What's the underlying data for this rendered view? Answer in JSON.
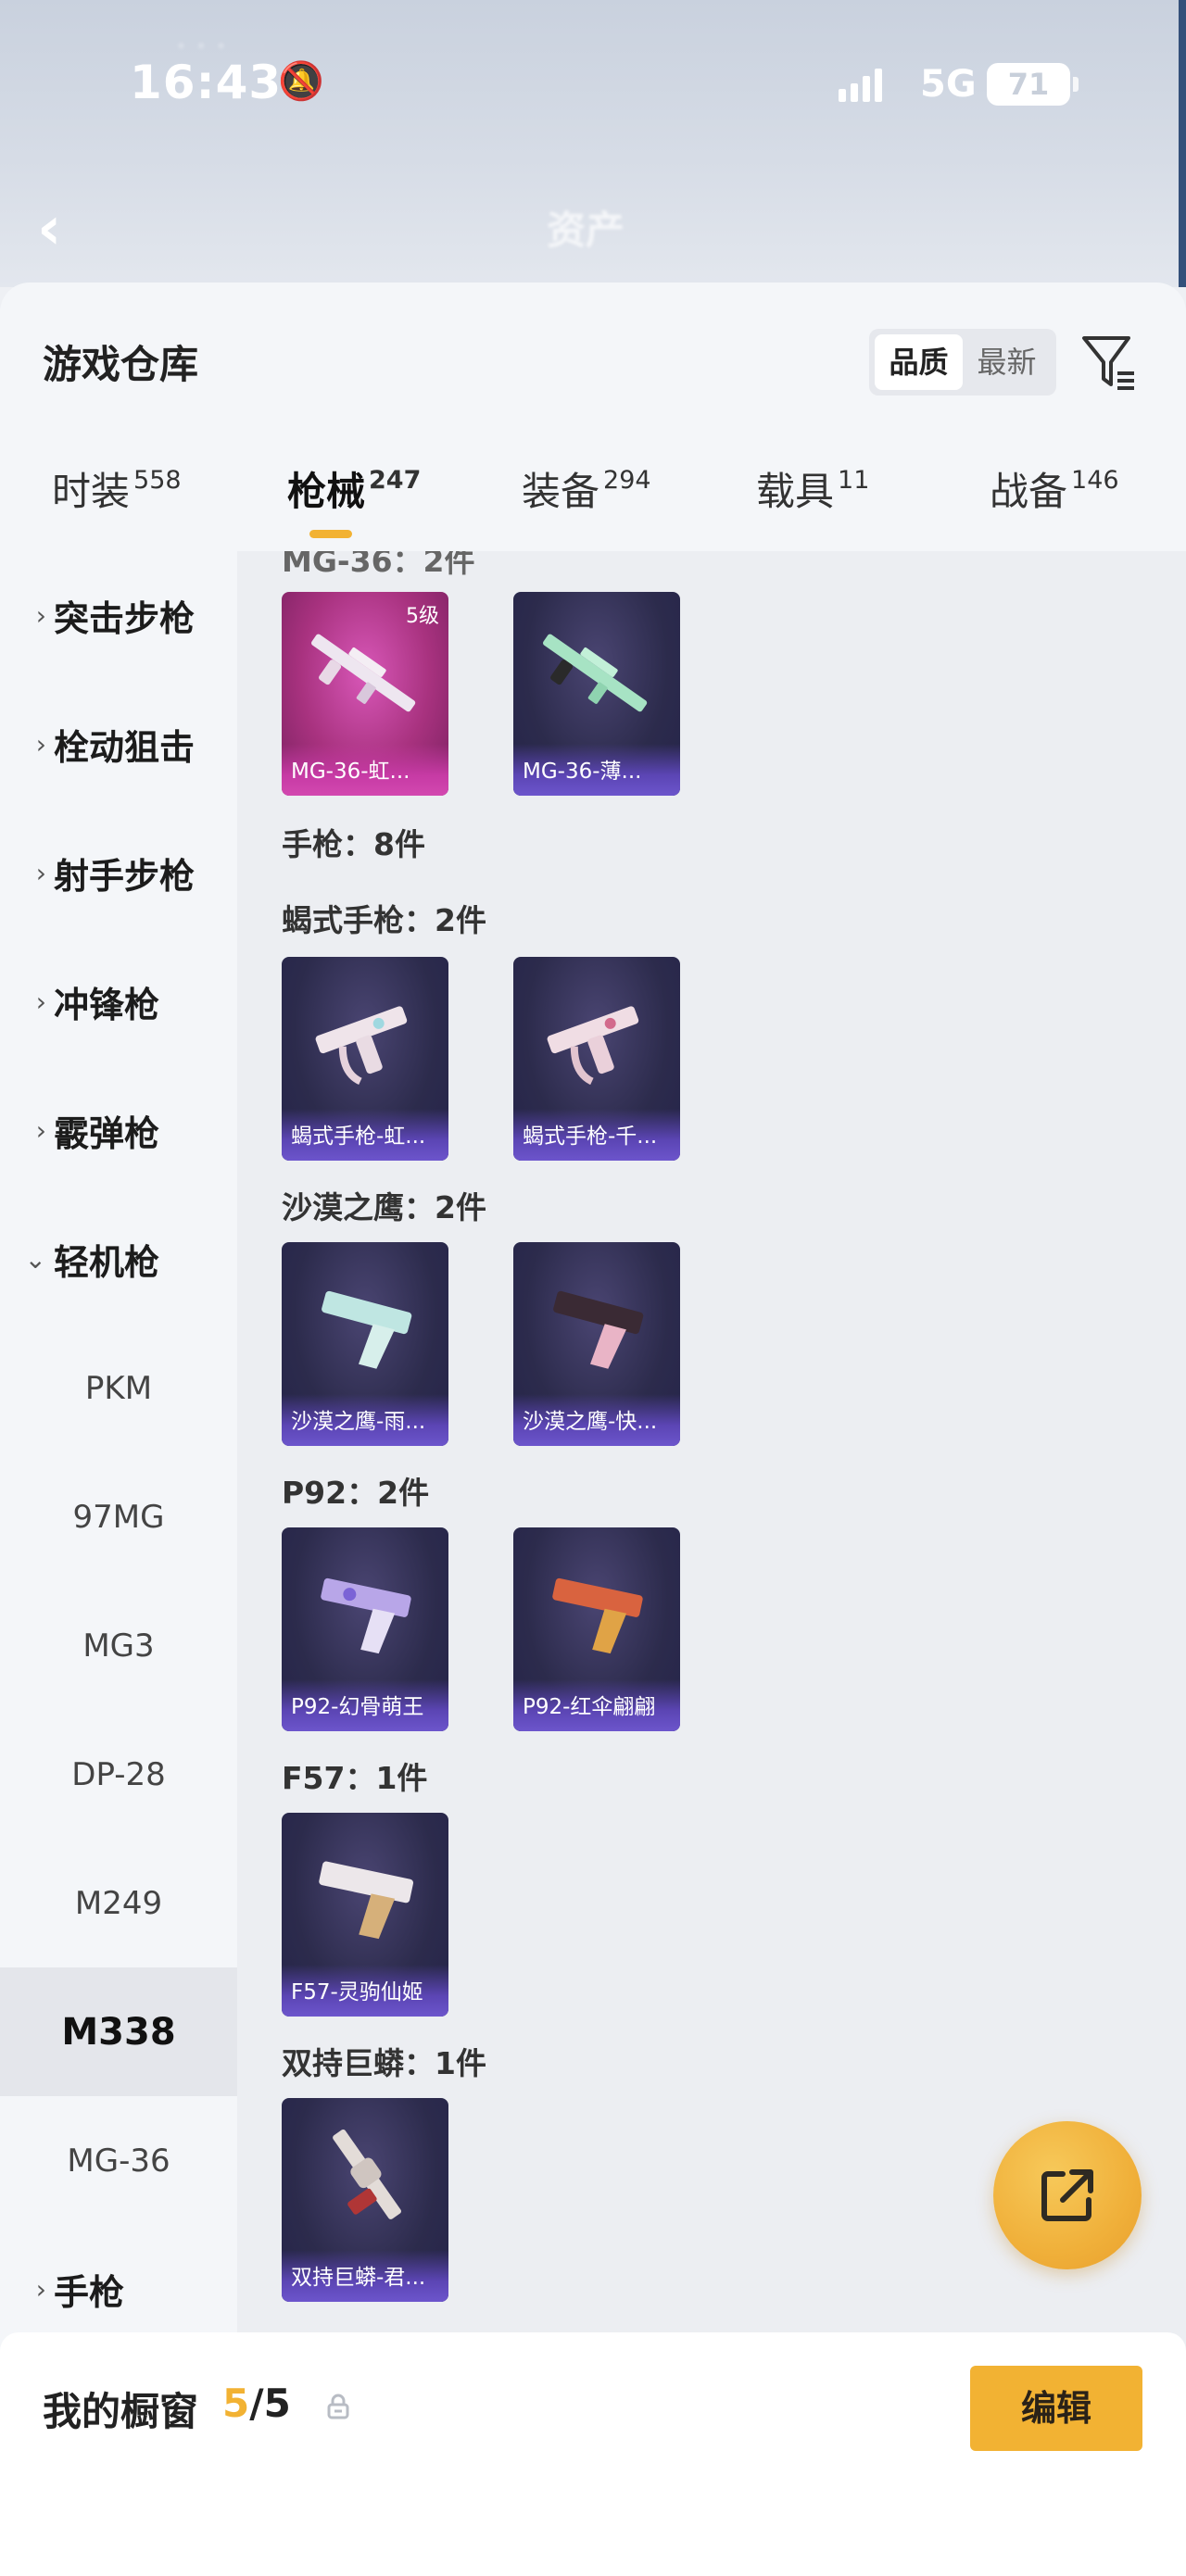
{
  "status_bar": {
    "time": "16:43",
    "network": "5G",
    "battery": "71"
  },
  "header": {
    "title": "资产",
    "back_icon": "chevron-left-icon"
  },
  "sheet": {
    "title": "游戏仓库",
    "sort": {
      "quality": "品质",
      "newest": "最新",
      "active": "quality"
    },
    "filter_icon": "filter-icon"
  },
  "tabs": [
    {
      "label": "时装",
      "count": "558"
    },
    {
      "label": "枪械",
      "count": "247",
      "active": true
    },
    {
      "label": "装备",
      "count": "294"
    },
    {
      "label": "载具",
      "count": "11"
    },
    {
      "label": "战备",
      "count": "146"
    }
  ],
  "sidebar": {
    "categories": [
      {
        "label": "突击步枪",
        "expanded": false
      },
      {
        "label": "栓动狙击",
        "expanded": false
      },
      {
        "label": "射手步枪",
        "expanded": false
      },
      {
        "label": "冲锋枪",
        "expanded": false
      },
      {
        "label": "霰弹枪",
        "expanded": false
      },
      {
        "label": "轻机枪",
        "expanded": true
      }
    ],
    "sub_items": [
      "PKM",
      "97MG",
      "MG3",
      "DP-28",
      "M249",
      "M338",
      "MG-36"
    ],
    "selected_sub": "M338",
    "bottom_category": {
      "label": "手枪",
      "expanded": false
    }
  },
  "content": {
    "top_partial_label": "MG-36：2件",
    "groups": [
      {
        "label": "手枪：8件"
      },
      {
        "label": "蝎式手枪：2件"
      },
      {
        "label": "沙漠之鹰：2件"
      },
      {
        "label": "P92：2件"
      },
      {
        "label": "F57：1件"
      },
      {
        "label": "双持巨蟒：1件"
      }
    ],
    "cards": {
      "mg36_1": {
        "name": "MG-36-虹...",
        "level": "5级"
      },
      "mg36_2": {
        "name": "MG-36-薄..."
      },
      "scorpion_1": {
        "name": "蝎式手枪-虹..."
      },
      "scorpion_2": {
        "name": "蝎式手枪-千..."
      },
      "deagle_1": {
        "name": "沙漠之鹰-雨..."
      },
      "deagle_2": {
        "name": "沙漠之鹰-快..."
      },
      "p92_1": {
        "name": "P92-幻骨萌王"
      },
      "p92_2": {
        "name": "P92-红伞翩翩"
      },
      "f57_1": {
        "name": "F57-灵驹仙姬"
      },
      "python_1": {
        "name": "双持巨蟒-君..."
      }
    }
  },
  "fab": {
    "icon": "share-export-icon"
  },
  "showcase": {
    "title": "我的橱窗",
    "count_current": "5",
    "count_sep": "/5",
    "lock_icon": "lock-icon",
    "edit_label": "编辑"
  },
  "colors": {
    "accent": "#f2b233",
    "card_dark": "#2c2b4c",
    "card_pink": "#a8327f"
  }
}
